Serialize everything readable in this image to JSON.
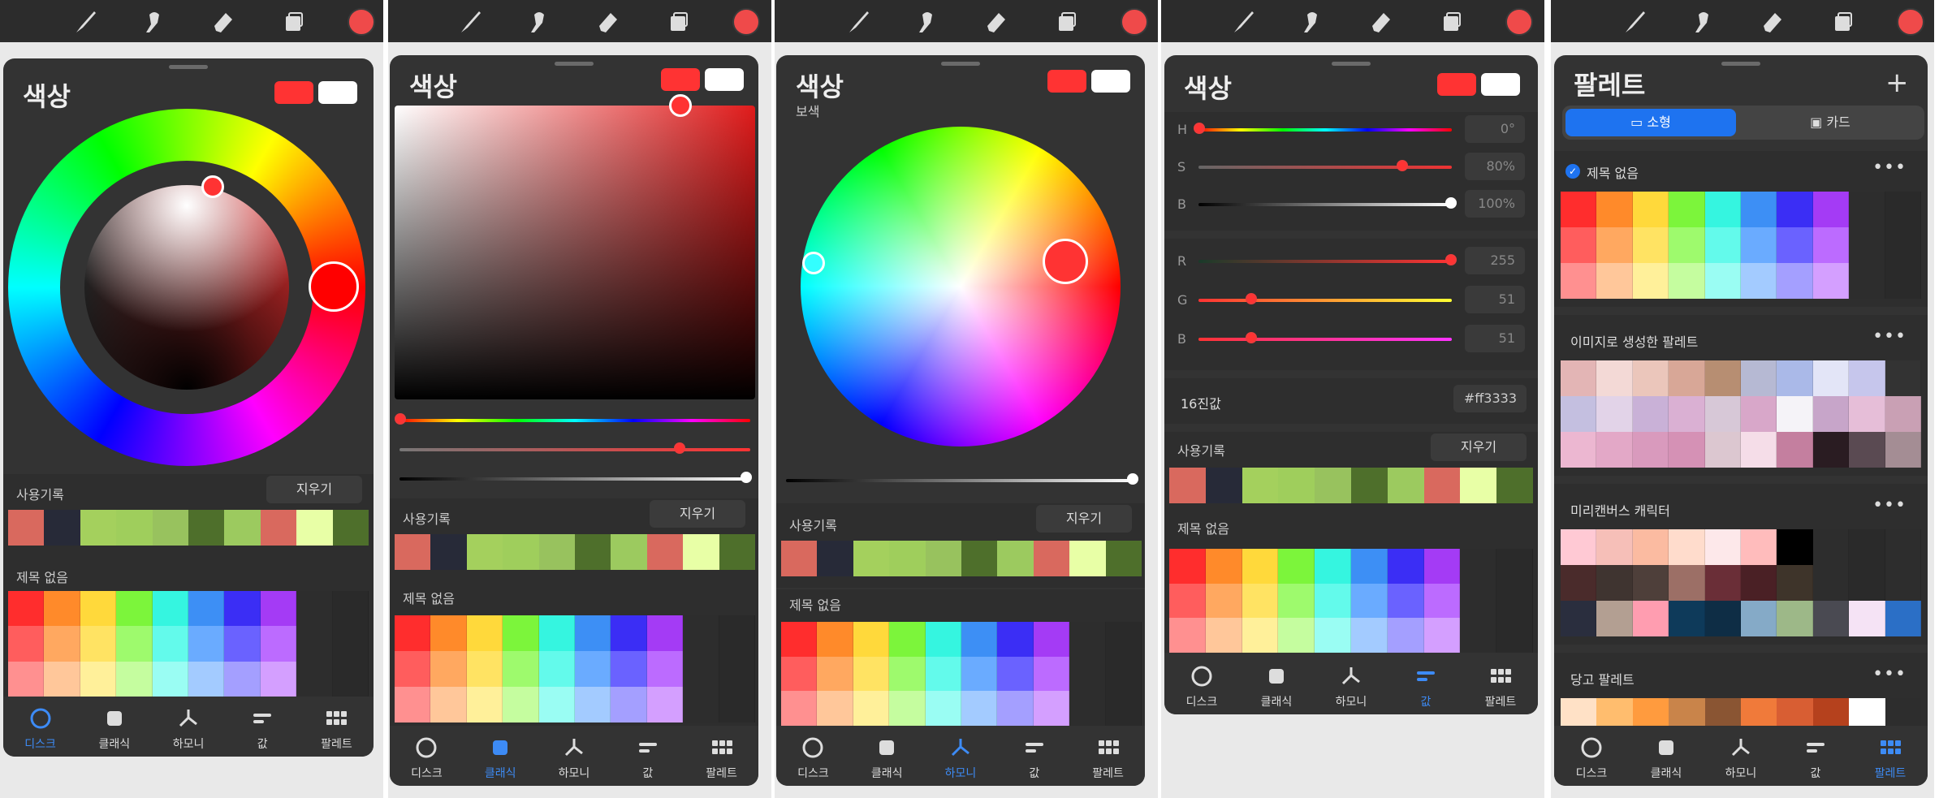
{
  "colors": {
    "current": "#ff3333",
    "secondary": "#ffffff",
    "accent": "#3d8bf5",
    "panel": "#333333"
  },
  "toolbar_icons": [
    "brush-icon",
    "smudge-icon",
    "eraser-icon",
    "layers-icon"
  ],
  "history_colors": [
    "#d9695e",
    "#272a38",
    "#a4d05d",
    "#9fce5c",
    "#98c25e",
    "#4e6f2b",
    "#9cca5f",
    "#d9695e",
    "#e8ffa6",
    "#4e6f2b"
  ],
  "palette_default": [
    [
      "#ff2d2d",
      "#ff8a2a",
      "#ffd93b",
      "#7cf53b",
      "#35f5e0",
      "#3d8ff5",
      "#3b2ef5",
      "#a43bf5",
      "#2d2d2d",
      "#2a2a2a"
    ],
    [
      "#ff5d5d",
      "#ffa860",
      "#ffe363",
      "#9efa6d",
      "#63faeb",
      "#6aabff",
      "#6a62ff",
      "#bc6bff",
      "#2d2d2d",
      "#2a2a2a"
    ],
    [
      "#ff9090",
      "#ffc79a",
      "#fff09a",
      "#c5fd9f",
      "#9afdf3",
      "#a3cbff",
      "#a49fff",
      "#d49fff",
      "#2d2d2d",
      "#2a2a2a"
    ]
  ],
  "palette_image": [
    [
      "#e3b5b5",
      "#f3d9d6",
      "#ebc6bb",
      "#d8a797",
      "#b78e72",
      "#b6b9d3",
      "#aab9e8",
      "#e3e5f7",
      "#c6c6ec",
      "#333333"
    ],
    [
      "#c4bfe0",
      "#e2d3e8",
      "#c9b1d7",
      "#dab0d3",
      "#d7c8d7",
      "#d8a7c9",
      "#f5f3f8",
      "#c7a5c9",
      "#e6bed8",
      "#c9a0b4"
    ],
    [
      "#ecb7d1",
      "#e3a8c7",
      "#d99abd",
      "#d591b5",
      "#dcc7d0",
      "#f5dde8",
      "#c47f9f",
      "#2a1c22",
      "#5a4a52",
      "#a48d94"
    ]
  ],
  "palette_miricanvas": [
    [
      "#ffc9d4",
      "#f6bfb8",
      "#fbbba1",
      "#ffdccc",
      "#fde8ea",
      "#ffbcbc",
      "#000000",
      "#2d2d2d",
      "#2a2a2a",
      "#2d2d2d"
    ],
    [
      "#4a2b2b",
      "#3f3430",
      "#4e3f3a",
      "#9c6f66",
      "#6a2e37",
      "#4a2025",
      "#3e342a",
      "#2d2d2d",
      "#2a2a2a",
      "#2d2d2d"
    ],
    [
      "#2a2e3e",
      "#b39f92",
      "#ff9db0",
      "#0e3a5a",
      "#0e2d45",
      "#85aac7",
      "#9db888",
      "#4a4a52",
      "#f5e3f5",
      "#2b6fc6"
    ]
  ],
  "palette_danggeun": [
    "#ffe1c6",
    "#ffbd6e",
    "#ff9b3e",
    "#c9844a",
    "#8a5533",
    "#f07a3a",
    "#d85e33",
    "#b5411d",
    "#ffffff",
    "#2d2d2d"
  ],
  "labels": {
    "title": "색상",
    "palettes_title": "팔레트",
    "history": "사용기록",
    "clear": "지우기",
    "untitled": "제목 없음",
    "complementary": "보색",
    "hex_label": "16진값",
    "hex_value": "#ff3333",
    "nav": [
      "디스크",
      "클래식",
      "하모니",
      "값",
      "팔레트"
    ],
    "tab_small": "소형",
    "tab_card": "카드",
    "palette_image_name": "이미지로 생성한 팔레트",
    "palette_miri_name": "미리캔버스 캐릭터",
    "palette_danggeun_name": "당고 팔레트",
    "more": "•••"
  },
  "values": {
    "H": {
      "label": "H",
      "value": "0°",
      "fraction": 0.0
    },
    "S": {
      "label": "S",
      "value": "80%",
      "fraction": 0.8
    },
    "B": {
      "label": "B",
      "value": "100%",
      "fraction": 1.0
    },
    "R": {
      "label": "R",
      "value": "255",
      "fraction": 1.0
    },
    "G": {
      "label": "G",
      "value": "51",
      "fraction": 0.2
    },
    "Bl": {
      "label": "B",
      "value": "51",
      "fraction": 0.2
    }
  }
}
